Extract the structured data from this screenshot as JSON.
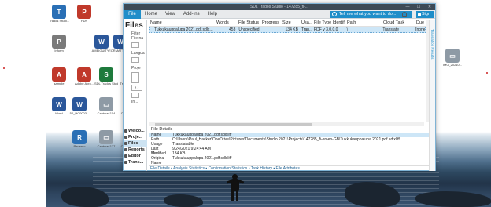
{
  "window": {
    "title": "SDL Trados Studio - 147285_fi-...",
    "controls": [
      "—",
      "☐",
      "✕"
    ]
  },
  "menu": {
    "file": "File",
    "items": [
      "Home",
      "View",
      "Add-Ins",
      "Help"
    ],
    "tell_me": "Tell me what you want to do...",
    "sign_in": "Sign In"
  },
  "left_panel": {
    "header": "Files",
    "filter_label": "Filter",
    "filename_label": "File na",
    "language_label": "Langua",
    "project_label": "Proje",
    "in_label": "In...",
    "nav": [
      "Welco...",
      "Proje...",
      "Files",
      "Reports",
      "Editor",
      "Trans..."
    ]
  },
  "file_list": {
    "columns": [
      "Name",
      "Words",
      "File Status",
      "Progress",
      "Size",
      "Usa...",
      "File Type Identifi...",
      "Path",
      "Cloud Task",
      "Due"
    ],
    "rows": [
      {
        "name": "Tukkukauppalupa 2021.pdf.sdlx...",
        "words": "453",
        "status": "Unspecified",
        "progress": "",
        "size": "134 KB",
        "usage": "Tran...",
        "filetype": "PDF v 3.0.0.0",
        "path": "\\",
        "cloud": "Translate",
        "due": "[none"
      }
    ]
  },
  "file_details": {
    "header": "File Details",
    "rows": [
      {
        "k": "Name",
        "v": "Tukkukauppalupa 2021.pdf.sdlxliff"
      },
      {
        "k": "Path",
        "v": "C:\\Users\\Paul_Hacker\\OneDrive\\Pictures\\Documents\\Studio 2021\\Projects\\147285_fi-en\\en-GB\\Tukkukauppalupa 2021.pdf.sdlxliff"
      },
      {
        "k": "Usage",
        "v": "Translatable"
      },
      {
        "k": "Last Modified",
        "v": "9/24/2021 9:24:44 AM"
      },
      {
        "k": "Size",
        "v": "134 KB"
      },
      {
        "k": "Original Name",
        "v": "Tukkukauppalupa 2021.pdf.sdlxliff"
      }
    ],
    "tabs": "File Details  ▪ Analysis Statistics  ▪ Confirmation Statistics  ▪ Task History  ▪ File Attributes"
  },
  "right_bar": {
    "label": "Translation Results"
  },
  "desktop": {
    "icons": [
      {
        "label": "Trados Studi...",
        "color": "#2a6fb5",
        "glyph": "T"
      },
      {
        "label": "PDF",
        "color": "#c0392b",
        "glyph": "P"
      },
      {
        "label": "AMBIGUITY...",
        "color": "#2b579a",
        "glyph": "W"
      },
      {
        "label": "FORMATTING...",
        "color": "#2b579a",
        "glyph": "W"
      },
      {
        "label": "Editor",
        "color": "#2b579a",
        "glyph": "W"
      },
      {
        "label": "Inform",
        "color": "#7a7a7a",
        "glyph": "P"
      },
      {
        "label": "sample",
        "color": "#c0392b",
        "glyph": "A"
      },
      {
        "label": "Adobe Acro...",
        "color": "#c0392b",
        "glyph": "A"
      },
      {
        "label": "SDL Trados Studio",
        "color": "#1e7a3c",
        "glyph": "S"
      },
      {
        "label": "Trados Proc...",
        "color": "#1e7a3c",
        "glyph": "T"
      },
      {
        "label": "Word",
        "color": "#2b579a",
        "glyph": "W"
      },
      {
        "label": "52_HC0003...",
        "color": "#2b579a",
        "glyph": "W"
      },
      {
        "label": "Capture1154",
        "color": "#8e9aa5",
        "glyph": "▭"
      },
      {
        "label": "Capture1114",
        "color": "#8e9aa5",
        "glyph": "▭"
      },
      {
        "label": "Auditi...",
        "color": "#2b579a",
        "glyph": "W"
      },
      {
        "label": "Reverso",
        "color": "#2a6fb5",
        "glyph": "R"
      },
      {
        "label": "Capture1137",
        "color": "#8e9aa5",
        "glyph": "▭"
      },
      {
        "label": "Capture1141",
        "color": "#8e9aa5",
        "glyph": "▭"
      },
      {
        "label": "IMG_20210...",
        "color": "#8e9aa5",
        "glyph": "▭"
      }
    ]
  }
}
